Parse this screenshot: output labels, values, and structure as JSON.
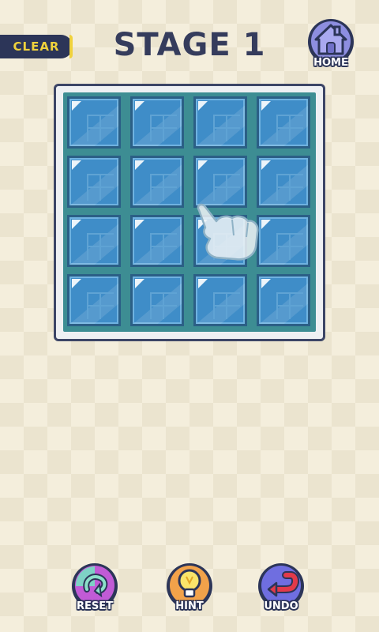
{
  "header": {
    "clear_label": "CLEAR",
    "stage_title": "STAGE 1",
    "home_label": "HOME"
  },
  "board": {
    "rows": 4,
    "cols": 4,
    "hint_hand": {
      "row": 3,
      "col": 3
    }
  },
  "controls": {
    "reset_label": "RESET",
    "hint_label": "HINT",
    "undo_label": "UNDO"
  },
  "colors": {
    "background": "#f4eedc",
    "tile": "#3f8dc8",
    "board_bg": "#3d8d93",
    "title": "#353c5c",
    "clear_text": "#f0d23c"
  },
  "icons": {
    "home": "house-icon",
    "reset": "reset-arrow-icon",
    "hint": "lightbulb-icon",
    "undo": "undo-arrow-icon",
    "hand": "pointing-hand-icon"
  }
}
